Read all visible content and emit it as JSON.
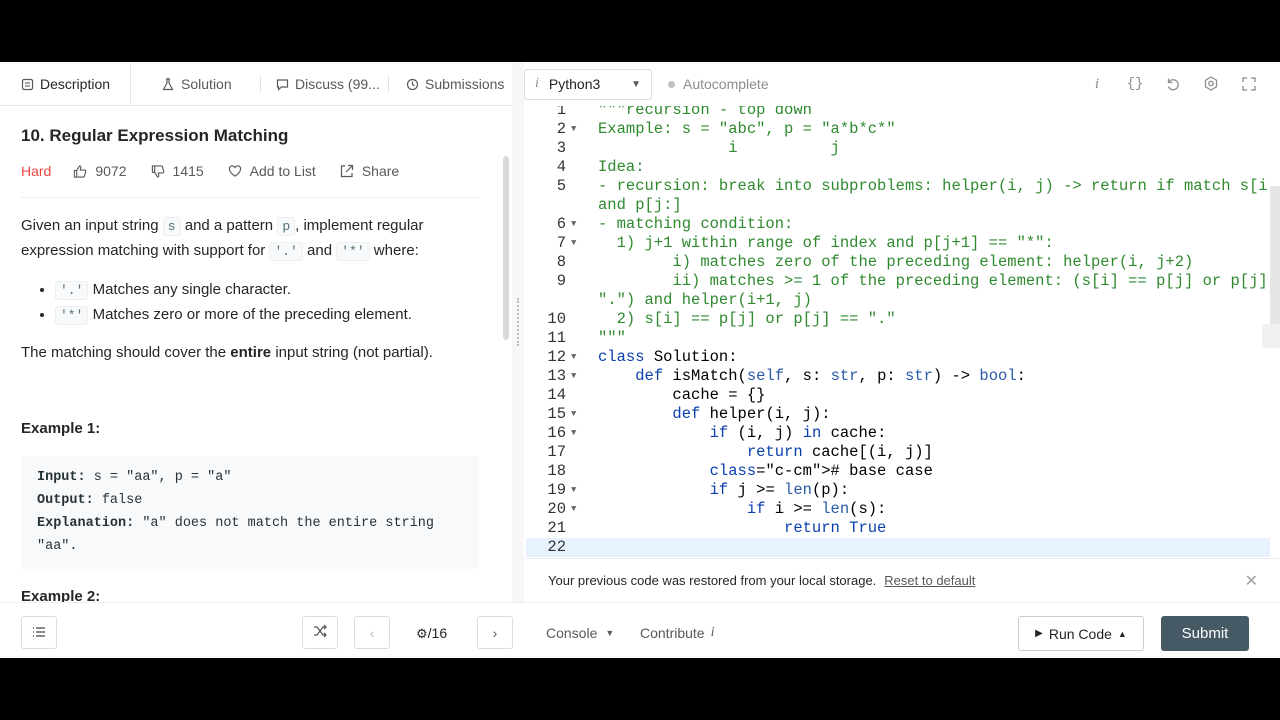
{
  "tabs": [
    {
      "label": "Description",
      "icon": "document-icon"
    },
    {
      "label": "Solution",
      "icon": "flask-icon"
    },
    {
      "label": "Discuss (99...",
      "icon": "chat-icon"
    },
    {
      "label": "Submissions",
      "icon": "clock-icon"
    }
  ],
  "problem": {
    "title": "10. Regular Expression Matching",
    "difficulty": "Hard",
    "likes": "9072",
    "dislikes": "1415",
    "add_to_list": "Add to List",
    "share": "Share",
    "intro_1": "Given an input string ",
    "intro_s": "s",
    "intro_2": " and a pattern ",
    "intro_p": "p",
    "intro_3": ", implement regular",
    "intro_4": "expression matching with support for ",
    "intro_dot": "'.'",
    "intro_and": " and ",
    "intro_star": "'*'",
    "intro_where": " where:",
    "bullets": [
      {
        "code": "'.'",
        "text": " Matches any single character."
      },
      {
        "code": "'*'",
        "text": " Matches zero or more of the preceding element."
      }
    ],
    "cover_1": "The matching should cover the ",
    "cover_bold": "entire",
    "cover_2": " input string (not partial).",
    "example1_heading": "Example 1:",
    "example1": {
      "input_label": "Input:",
      "input": " s = \"aa\", p = \"a\"",
      "output_label": "Output:",
      "output": " false",
      "explanation_label": "Explanation:",
      "explanation_1": " \"a\" does not match the entire string",
      "explanation_2": "\"aa\"."
    },
    "example2_heading": "Example 2:"
  },
  "editor": {
    "language": "Python3",
    "autocomplete": "Autocomplete",
    "line_numbers": [
      "1",
      "2",
      "3",
      "4",
      "5",
      "",
      "6",
      "7",
      "8",
      "9",
      "",
      "10",
      "11",
      "12",
      "13",
      "14",
      "15",
      "16",
      "17",
      "18",
      "19",
      "20",
      "21",
      "22"
    ],
    "lines": [
      "\"\"\"recursion - top down",
      "Example: s = \"abc\", p = \"a*b*c*\"",
      "              i          j",
      "Idea:",
      "- recursion: break into subproblems: helper(i, j) -> return if match s[i:]",
      "and p[j:]",
      "- matching condition:",
      "  1) j+1 within range of index and p[j+1] == \"*\":",
      "        i) matches zero of the preceding element: helper(i, j+2)",
      "        ii) matches >= 1 of the preceding element: (s[i] == p[j] or p[j] ==",
      "\".\") and helper(i+1, j)",
      "  2) s[i] == p[j] or p[j] == \".\"",
      "\"\"\"",
      "class Solution:",
      "    def isMatch(self, s: str, p: str) -> bool:",
      "        cache = {}",
      "        def helper(i, j):",
      "            if (i, j) in cache:",
      "                return cache[(i, j)]",
      "            # base case",
      "            if j >= len(p):",
      "                if i >= len(s):",
      "                    return True",
      ""
    ]
  },
  "restore": {
    "message": "Your previous code was restored from your local storage.",
    "reset_link": "Reset to default"
  },
  "bottom": {
    "pager": "/16",
    "console": "Console",
    "contribute": "Contribute",
    "run_code": "Run Code",
    "submit": "Submit"
  }
}
